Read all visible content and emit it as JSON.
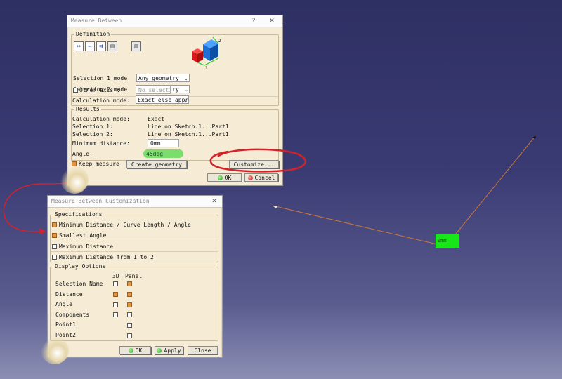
{
  "measure_between": {
    "title": "Measure Between",
    "help": "?",
    "close": "✕",
    "definition": {
      "legend": "Definition",
      "selection1_label": "Selection 1 mode:",
      "selection1_value": "Any geometry",
      "selection2_label": "Selection 2 mode:",
      "selection2_value": "Any geometry",
      "other_axis_label": "Other axis :",
      "other_axis_value": "No selection",
      "calc_mode_label": "Calculation mode:",
      "calc_mode_value": "Exact else approximate"
    },
    "results": {
      "legend": "Results",
      "rows": [
        {
          "label": "Calculation mode:",
          "value": "Exact"
        },
        {
          "label": "Selection 1:",
          "value": "Line on Sketch.1...Part1"
        },
        {
          "label": "Selection 2:",
          "value": "Line on Sketch.1...Part1"
        }
      ],
      "min_distance_label": "Minimum distance:",
      "min_distance_value": "0mm",
      "angle_label": "Angle:",
      "angle_value": "45deg"
    },
    "keep_measure_label": "Keep measure",
    "keep_measure_checked": true,
    "create_geometry_label": "Create geometry",
    "customize_label": "Customize...",
    "ok_label": "OK",
    "cancel_label": "Cancel"
  },
  "customization": {
    "title": "Measure Between Customization",
    "close": "✕",
    "specifications": {
      "legend": "Specifications",
      "items": [
        {
          "label": "Minimum Distance / Curve Length / Angle",
          "checked": true
        },
        {
          "label": "Smallest Angle",
          "checked": true
        }
      ],
      "max_distance_label": "Maximum Distance",
      "max_distance_checked": false,
      "max_distance_1_2_label": "Maximum Distance from 1 to 2",
      "max_distance_1_2_checked": false
    },
    "display_options": {
      "legend": "Display Options",
      "col_3d": "3D",
      "col_panel": "Panel",
      "rows": [
        {
          "label": "Selection Name",
          "d3": false,
          "panel": true
        },
        {
          "label": "Distance",
          "d3": true,
          "panel": true
        },
        {
          "label": "Angle",
          "d3": false,
          "panel": true
        },
        {
          "label": "Components",
          "d3": false,
          "panel": false
        },
        {
          "label": "Point1",
          "d3": null,
          "panel": false
        },
        {
          "label": "Point2",
          "d3": null,
          "panel": false
        }
      ]
    },
    "ok_label": "OK",
    "apply_label": "Apply",
    "close_label": "Close"
  },
  "viewport": {
    "measure_tag": "0mm"
  },
  "colors": {
    "annotation_red": "#d3222a",
    "measure_line": "#c8783a",
    "tag_green": "#19e619"
  }
}
